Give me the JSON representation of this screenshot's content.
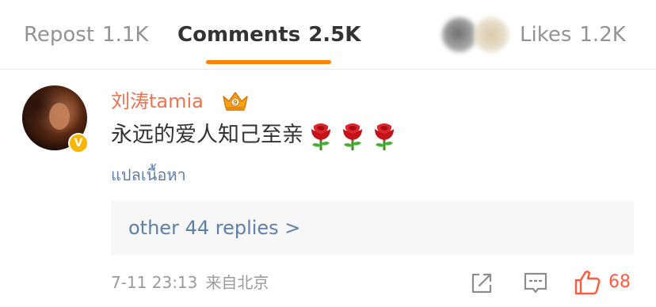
{
  "tabs": {
    "repost": {
      "label": "Repost",
      "count": "1.1K"
    },
    "comments": {
      "label": "Comments",
      "count": "2.5K"
    },
    "likes": {
      "label": "Likes",
      "count": "1.2K"
    }
  },
  "comment": {
    "username": "刘涛tamia",
    "text": "永远的爱人知己至亲",
    "emoji": [
      "rose-icon",
      "rose-icon",
      "rose-icon"
    ],
    "translate_label": "แปลเนื้อหา",
    "replies_label": "other 44 replies >",
    "date": "7-11 23:13",
    "source": "来自北京",
    "like_count": "68"
  },
  "icons": {
    "crown": "crown-icon",
    "verified": "verified-badge-icon",
    "share": "share-icon",
    "comment": "comment-icon",
    "like": "thumbs-up-icon"
  },
  "colors": {
    "accent": "#ff8200",
    "username": "#eb7350",
    "link": "#5d7fa9",
    "like": "#ff5a3c",
    "muted": "#9a9a9a"
  }
}
